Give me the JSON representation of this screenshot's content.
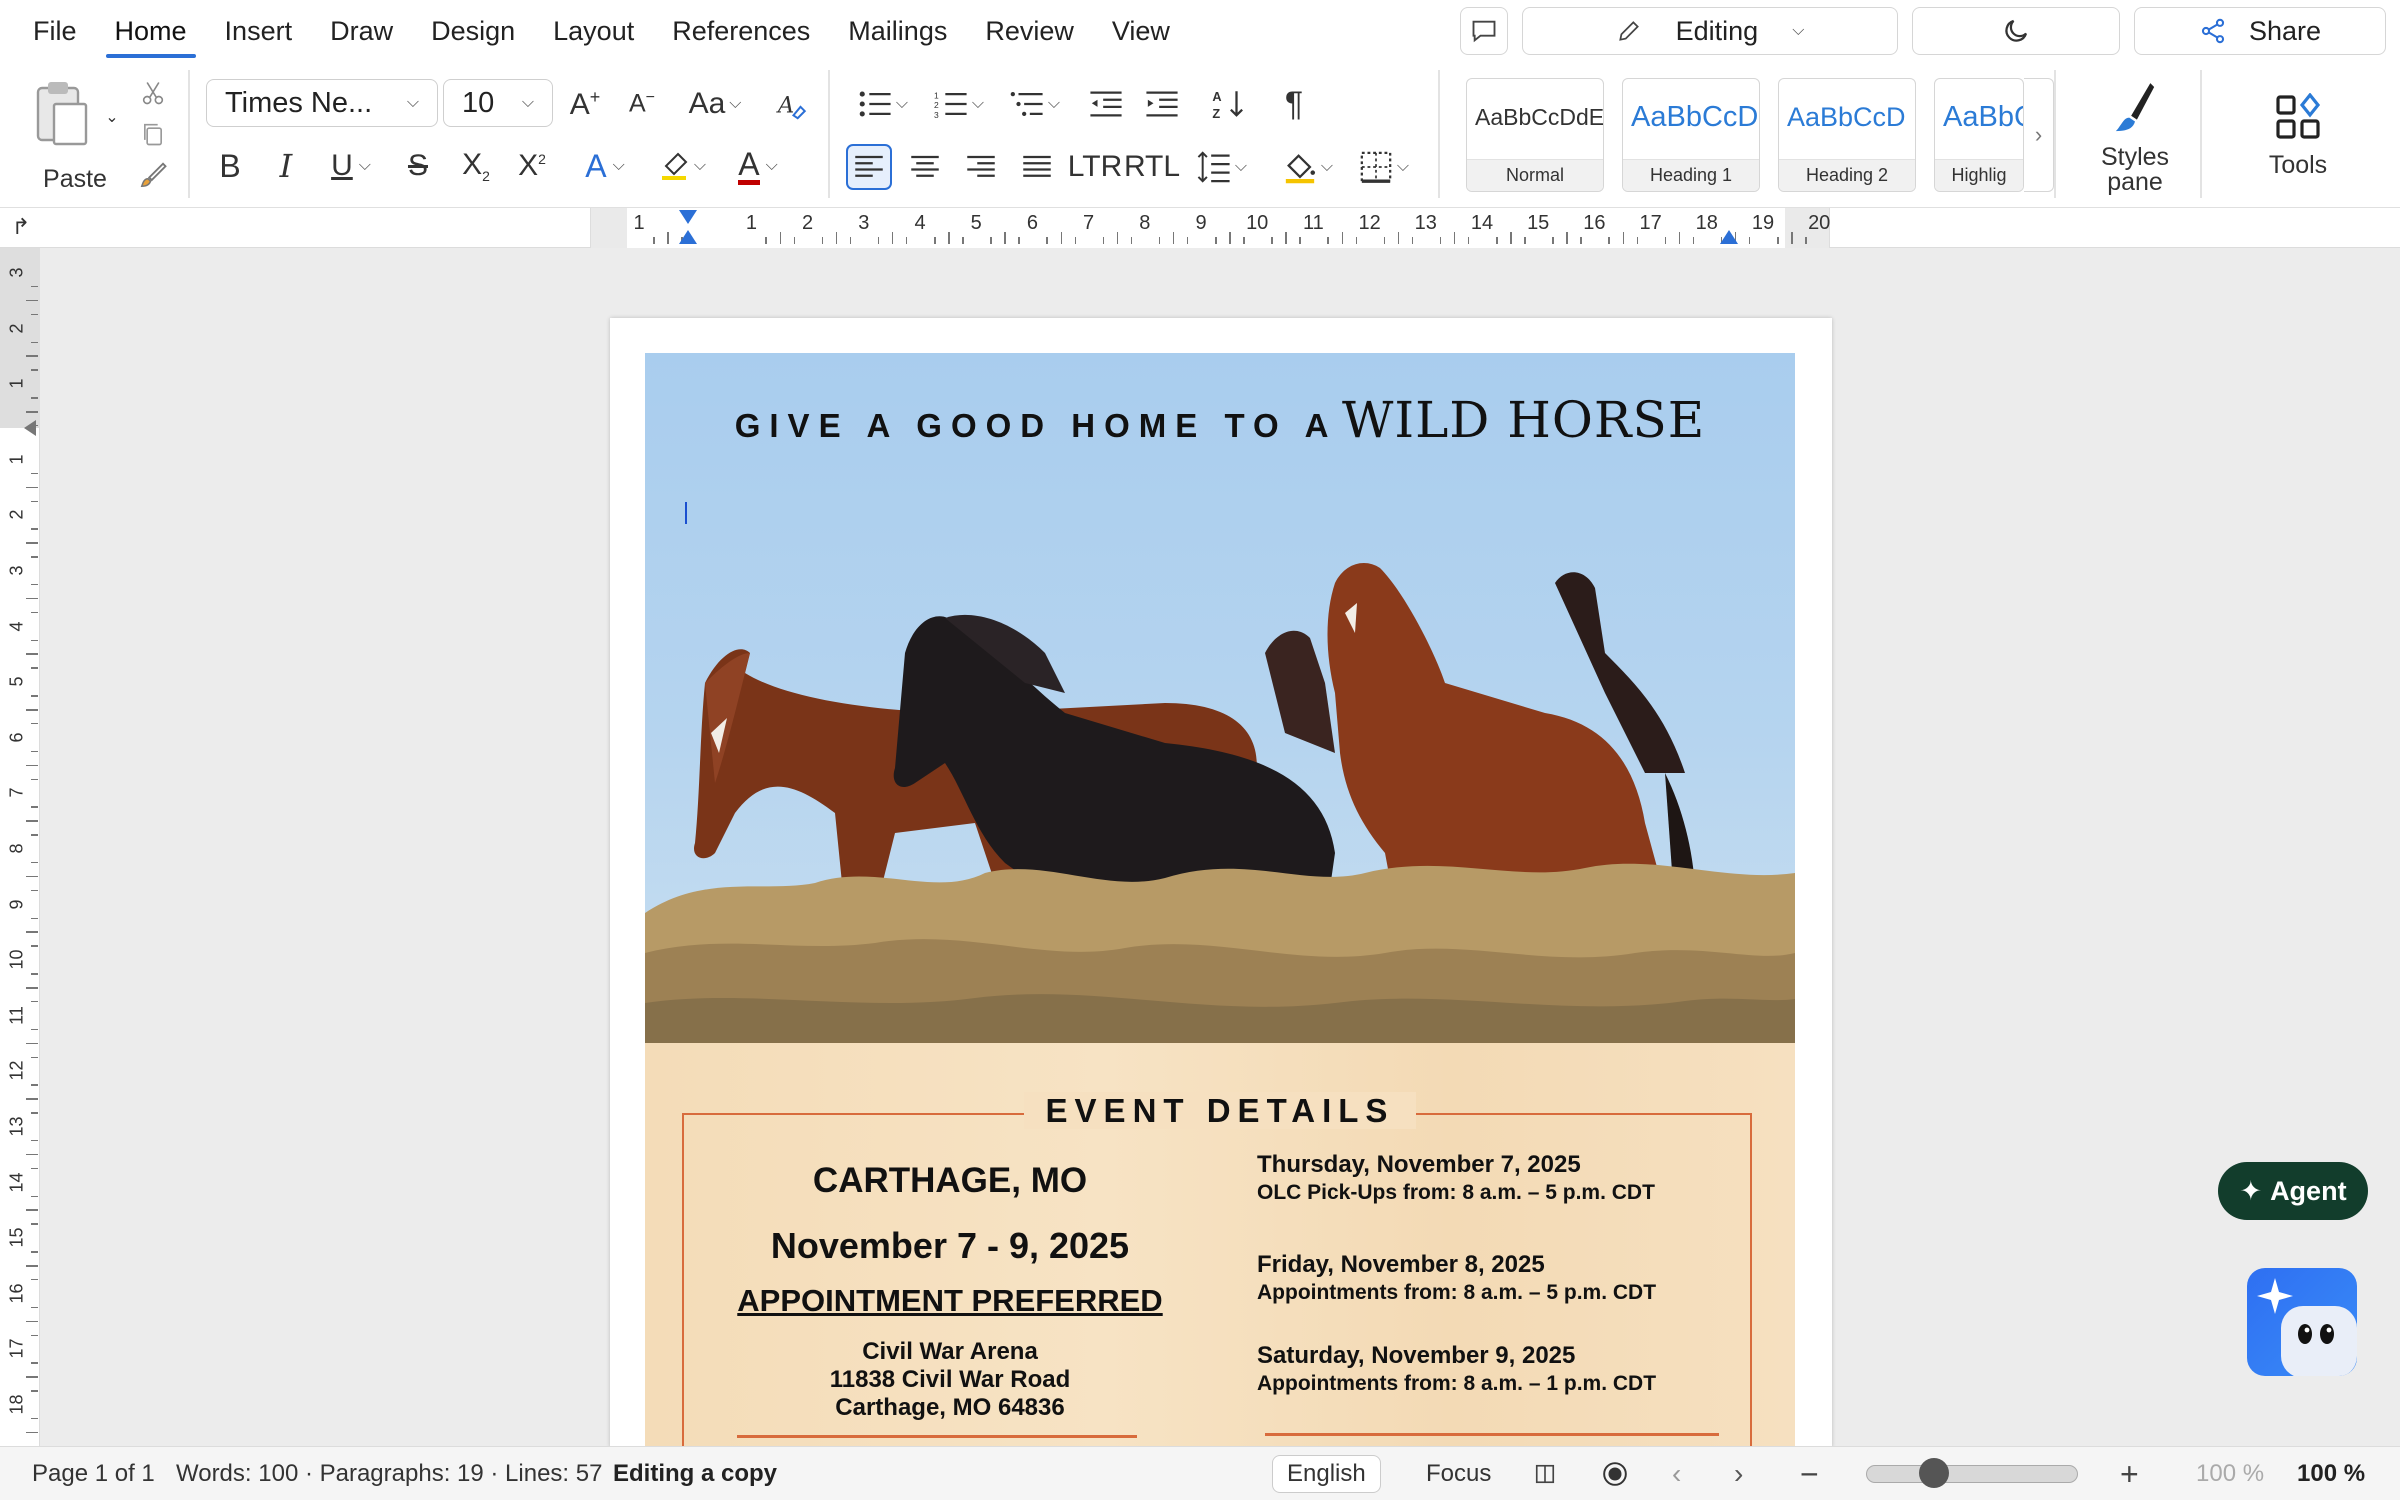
{
  "menu": {
    "items": [
      "File",
      "Home",
      "Insert",
      "Draw",
      "Design",
      "Layout",
      "References",
      "Mailings",
      "Review",
      "View"
    ],
    "active": "Home"
  },
  "topbar": {
    "mode_label": "Editing",
    "share_label": "Share"
  },
  "ribbon": {
    "paste_label": "Paste",
    "font_name": "Times Ne...",
    "font_size": "10",
    "case_label": "Aa",
    "ltr_label": "LTR",
    "rtl_label": "RTL",
    "styles": [
      {
        "preview": "AaBbCcDdE",
        "label": "Normal",
        "color": "#333333"
      },
      {
        "preview": "AaBbCcD",
        "label": "Heading 1",
        "color": "#2b7bd6"
      },
      {
        "preview": "AaBbCcD",
        "label": "Heading 2",
        "color": "#2b7bd6"
      },
      {
        "preview": "AaBbC",
        "label": "Highlig",
        "color": "#2b7bd6"
      }
    ],
    "styles_pane_label": "Styles pane",
    "tools_label": "Tools"
  },
  "ruler": {
    "h_numbers": [
      "1",
      "1",
      "2",
      "3",
      "4",
      "5",
      "6",
      "7",
      "8",
      "9",
      "10",
      "11",
      "12",
      "13",
      "14",
      "15",
      "16",
      "17",
      "18",
      "19",
      "20"
    ],
    "v_numbers": [
      "3",
      "2",
      "1",
      "1",
      "2",
      "3",
      "4",
      "5",
      "6",
      "7",
      "8",
      "9",
      "10",
      "11",
      "12",
      "13",
      "14",
      "15",
      "16",
      "17",
      "18"
    ]
  },
  "document": {
    "headline_small": "GIVE A GOOD HOME TO A",
    "headline_big": "WILD HORSE",
    "section_title": "EVENT DETAILS",
    "city": "CARTHAGE, MO",
    "dates": "November 7 - 9, 2025",
    "appointment": "APPOINTMENT PREFERRED",
    "venue_lines": [
      "Civil War Arena",
      "11838 Civil War Road",
      "Carthage, MO 64836"
    ],
    "schedule": [
      {
        "day": "Thursday, November 7, 2025",
        "detail": "OLC Pick-Ups from: 8 a.m. – 5 p.m. CDT"
      },
      {
        "day": "Friday, November 8, 2025",
        "detail": "Appointments from: 8 a.m. – 5 p.m. CDT"
      },
      {
        "day": "Saturday, November 9, 2025",
        "detail": "Appointments from: 8 a.m. – 1 p.m. CDT"
      }
    ]
  },
  "floating": {
    "agent_label": "Agent"
  },
  "status": {
    "page": "Page 1 of 1",
    "stats": "Words: 100 · Paragraphs: 19 · Lines: 57",
    "mode": "Editing a copy",
    "language": "English",
    "focus": "Focus",
    "zoom_input": "100 %",
    "zoom_value": "100 %"
  },
  "colors": {
    "accent": "#2b6fd6",
    "frame": "#d86b3c",
    "agent_bg": "#123d2c"
  }
}
